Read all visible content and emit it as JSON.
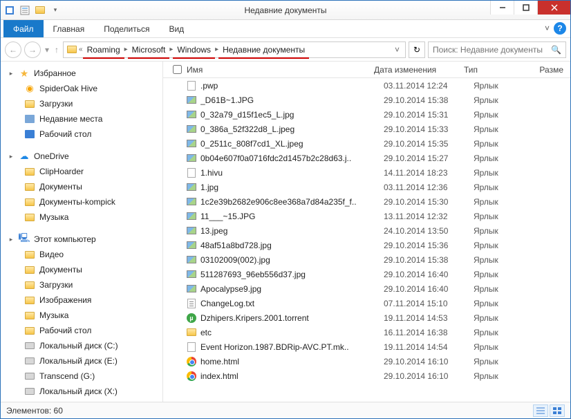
{
  "window": {
    "title": "Недавние документы"
  },
  "ribbon": {
    "file": "Файл",
    "tabs": [
      "Главная",
      "Поделиться",
      "Вид"
    ]
  },
  "address": {
    "prefix": "«",
    "segments": [
      "Roaming",
      "Microsoft",
      "Windows",
      "Недавние документы"
    ]
  },
  "search": {
    "placeholder": "Поиск: Недавние документы"
  },
  "sidebar": {
    "favorites": {
      "label": "Избранное",
      "items": [
        {
          "label": "SpiderOak Hive",
          "icon": "spideroak"
        },
        {
          "label": "Загрузки",
          "icon": "folder"
        },
        {
          "label": "Недавние места",
          "icon": "recent"
        },
        {
          "label": "Рабочий стол",
          "icon": "desktop"
        }
      ]
    },
    "onedrive": {
      "label": "OneDrive",
      "items": [
        {
          "label": "ClipHoarder",
          "icon": "folder"
        },
        {
          "label": "Документы",
          "icon": "folder"
        },
        {
          "label": "Документы-kompick",
          "icon": "folder"
        },
        {
          "label": "Музыка",
          "icon": "folder"
        }
      ]
    },
    "thispc": {
      "label": "Этот компьютер",
      "items": [
        {
          "label": "Видео",
          "icon": "folder"
        },
        {
          "label": "Документы",
          "icon": "folder"
        },
        {
          "label": "Загрузки",
          "icon": "folder"
        },
        {
          "label": "Изображения",
          "icon": "folder"
        },
        {
          "label": "Музыка",
          "icon": "folder"
        },
        {
          "label": "Рабочий стол",
          "icon": "folder"
        },
        {
          "label": "Локальный диск (C:)",
          "icon": "drive"
        },
        {
          "label": "Локальный диск (E:)",
          "icon": "drive"
        },
        {
          "label": "Transcend (G:)",
          "icon": "drive"
        },
        {
          "label": "Локальный диск (X:)",
          "icon": "drive"
        }
      ]
    }
  },
  "columns": {
    "name": "Имя",
    "date": "Дата изменения",
    "type": "Тип",
    "size": "Разме"
  },
  "files": [
    {
      "name": ".pwp",
      "date": "03.11.2014 12:24",
      "type": "Ярлык",
      "icon": "file"
    },
    {
      "name": "_D61B~1.JPG",
      "date": "29.10.2014 15:38",
      "type": "Ярлык",
      "icon": "img"
    },
    {
      "name": "0_32a79_d15f1ec5_L.jpg",
      "date": "29.10.2014 15:31",
      "type": "Ярлык",
      "icon": "img"
    },
    {
      "name": "0_386a_52f322d8_L.jpeg",
      "date": "29.10.2014 15:33",
      "type": "Ярлык",
      "icon": "img"
    },
    {
      "name": "0_2511c_808f7cd1_XL.jpeg",
      "date": "29.10.2014 15:35",
      "type": "Ярлык",
      "icon": "img"
    },
    {
      "name": "0b04e607f0a0716fdc2d1457b2c28d63.j..",
      "date": "29.10.2014 15:27",
      "type": "Ярлык",
      "icon": "img"
    },
    {
      "name": "1.hivu",
      "date": "14.11.2014 18:23",
      "type": "Ярлык",
      "icon": "file"
    },
    {
      "name": "1.jpg",
      "date": "03.11.2014 12:36",
      "type": "Ярлык",
      "icon": "img"
    },
    {
      "name": "1c2e39b2682e906c8ee368a7d84a235f_f..",
      "date": "29.10.2014 15:30",
      "type": "Ярлык",
      "icon": "img"
    },
    {
      "name": "11___~15.JPG",
      "date": "13.11.2014 12:32",
      "type": "Ярлык",
      "icon": "img"
    },
    {
      "name": "13.jpeg",
      "date": "24.10.2014 13:50",
      "type": "Ярлык",
      "icon": "img"
    },
    {
      "name": "48af51a8bd728.jpg",
      "date": "29.10.2014 15:36",
      "type": "Ярлык",
      "icon": "img"
    },
    {
      "name": "03102009(002).jpg",
      "date": "29.10.2014 15:38",
      "type": "Ярлык",
      "icon": "img"
    },
    {
      "name": "511287693_96eb556d37.jpg",
      "date": "29.10.2014 16:40",
      "type": "Ярлык",
      "icon": "img"
    },
    {
      "name": "Apocalypse9.jpg",
      "date": "29.10.2014 16:40",
      "type": "Ярлык",
      "icon": "img"
    },
    {
      "name": "ChangeLog.txt",
      "date": "07.11.2014 15:10",
      "type": "Ярлык",
      "icon": "txt"
    },
    {
      "name": "Dzhipers.Kripers.2001.torrent",
      "date": "19.11.2014 14:53",
      "type": "Ярлык",
      "icon": "torrent"
    },
    {
      "name": "etc",
      "date": "16.11.2014 16:38",
      "type": "Ярлык",
      "icon": "folder"
    },
    {
      "name": "Event Horizon.1987.BDRip-AVC.PT.mk..",
      "date": "19.11.2014 14:54",
      "type": "Ярлык",
      "icon": "file"
    },
    {
      "name": "home.html",
      "date": "29.10.2014 16:10",
      "type": "Ярлык",
      "icon": "chrome"
    },
    {
      "name": "index.html",
      "date": "29.10.2014 16:10",
      "type": "Ярлык",
      "icon": "chrome"
    }
  ],
  "status": {
    "count_label": "Элементов:",
    "count": "60"
  }
}
